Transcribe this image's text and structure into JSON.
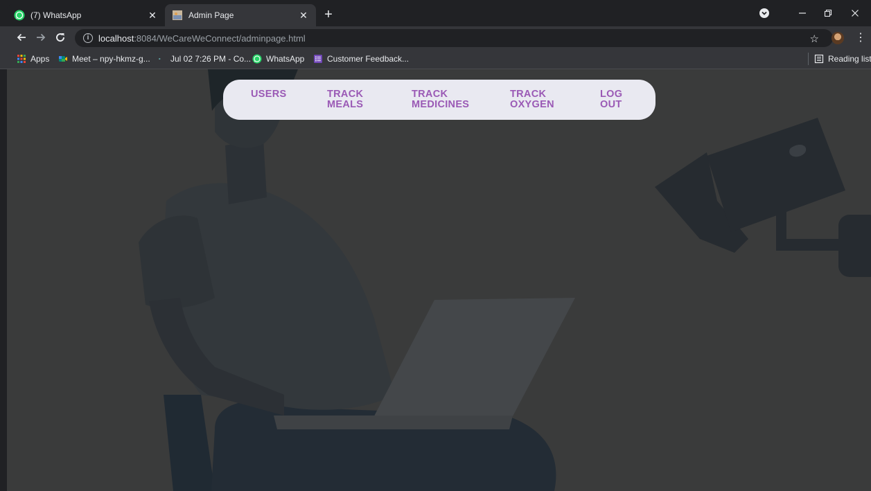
{
  "tabs": [
    {
      "title": "(7) WhatsApp",
      "active": false,
      "icon": "whatsapp-icon"
    },
    {
      "title": "Admin Page",
      "active": true,
      "icon": "page-thumbnail-icon"
    }
  ],
  "toolbar": {
    "url_host": "localhost",
    "url_rest": ":8084/WeCareWeConnect/adminpage.html"
  },
  "bookmarks": {
    "items": [
      {
        "label": "Apps",
        "icon": "apps-grid-icon"
      },
      {
        "label": "Meet – npy-hkmz-g...",
        "icon": "google-meet-icon"
      },
      {
        "label": "Jul 02 7:26 PM - Co...",
        "icon": "dot-icon"
      },
      {
        "label": "WhatsApp",
        "icon": "whatsapp-icon"
      },
      {
        "label": "Customer Feedback...",
        "icon": "forms-icon"
      }
    ],
    "reading_list": "Reading list"
  },
  "nav": {
    "users": [
      "USERS"
    ],
    "track_meals": [
      "TRACK",
      "MEALS"
    ],
    "track_medicines": [
      "TRACK",
      "MEDICINES"
    ],
    "track_oxygen": [
      "TRACK",
      "OXYGEN"
    ],
    "logout": [
      "LOG",
      "OUT"
    ]
  },
  "colors": {
    "nav_text": "#9a59b5",
    "nav_bg": "#e9e9f1",
    "page_bg": "#3a3b3b",
    "chrome_frame": "#202124",
    "chrome_toolbar": "#35363a"
  }
}
